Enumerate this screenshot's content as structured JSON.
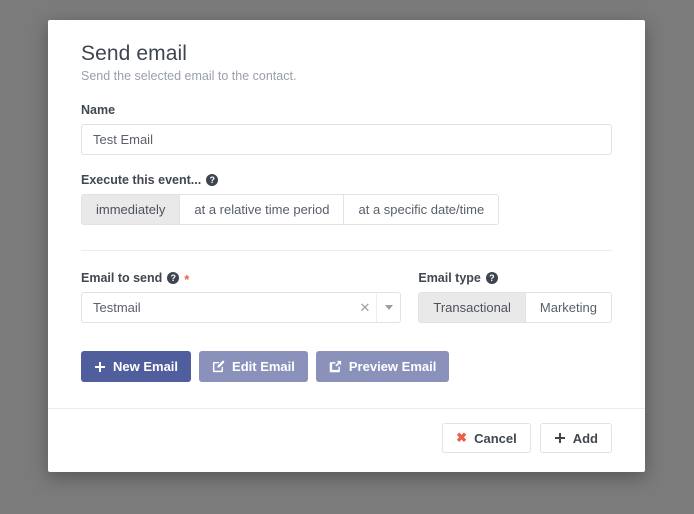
{
  "modal": {
    "title": "Send email",
    "subtitle": "Send the selected email to the contact.",
    "name_field": {
      "label": "Name",
      "value": "Test Email",
      "placeholder": "Name"
    },
    "execute_field": {
      "label": "Execute this event...",
      "help_icon": "question-mark-circle-icon",
      "help_glyph": "?",
      "options": [
        {
          "label": "immediately",
          "selected": true
        },
        {
          "label": "at a relative time period",
          "selected": false
        },
        {
          "label": "at a specific date/time",
          "selected": false
        }
      ]
    },
    "email_to_send": {
      "label": "Email to send",
      "help_icon": "question-mark-circle-icon",
      "help_glyph": "?",
      "required_marker": "*",
      "value": "Testmail",
      "clear_icon": "close-x-icon",
      "clear_glyph": "✕",
      "caret_icon": "chevron-down-icon"
    },
    "email_type": {
      "label": "Email type",
      "help_icon": "question-mark-circle-icon",
      "help_glyph": "?",
      "options": [
        {
          "label": "Transactional",
          "selected": true
        },
        {
          "label": "Marketing",
          "selected": false
        }
      ]
    },
    "actions": [
      {
        "label": "New Email",
        "icon": "plus-icon",
        "style": "primary"
      },
      {
        "label": "Edit Email",
        "icon": "pencil-square-icon",
        "style": "muted"
      },
      {
        "label": "Preview Email",
        "icon": "external-link-icon",
        "style": "muted"
      }
    ],
    "footer": {
      "cancel_label": "Cancel",
      "cancel_icon": "close-x-icon",
      "cancel_glyph": "✖",
      "add_label": "Add",
      "add_icon": "plus-icon"
    }
  },
  "colors": {
    "backdrop": "#7b7b7b",
    "primary_button": "#515e9e",
    "muted_button": "#8a92bb",
    "accent_red": "#ec5f4a",
    "active_segment": "#e9e9e9",
    "text_dark": "#3e4551",
    "text_muted": "#9aa0a9",
    "border": "#dfe2e6"
  }
}
